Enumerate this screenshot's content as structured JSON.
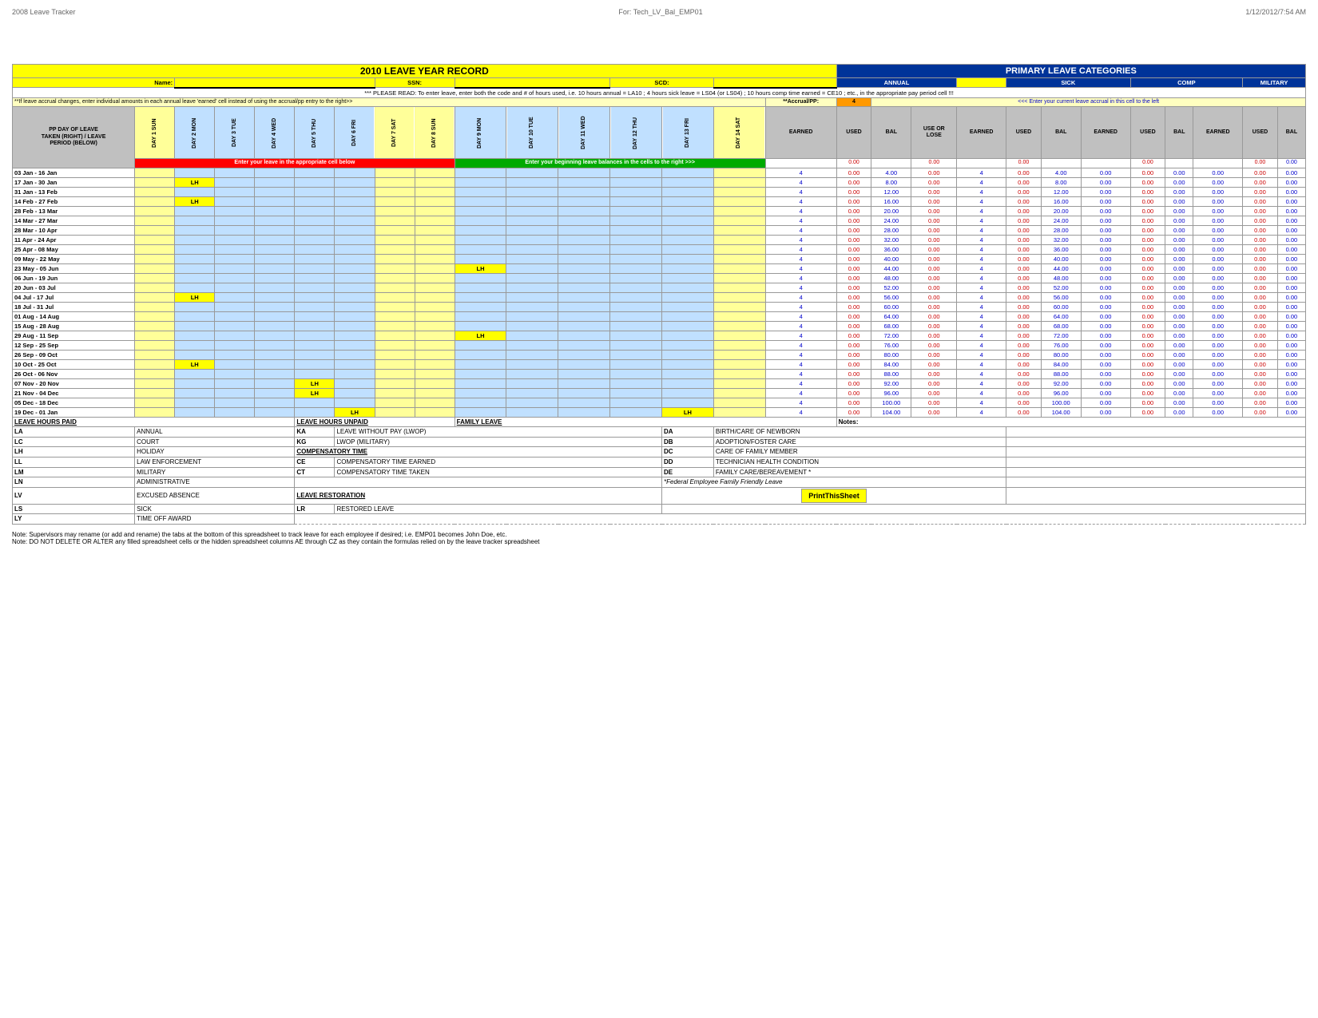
{
  "header": {
    "left": "2008 Leave Tracker",
    "center": "For: Tech_LV_Bal_EMP01",
    "right": "1/12/2012/7:54 AM"
  },
  "title": "2010 LEAVE YEAR RECORD",
  "primary_title": "PRIMARY LEAVE CATEGORIES",
  "labels": {
    "name": "Name:",
    "ssn": "SSN:",
    "scd": "SCD:",
    "annual": "ANNUAL",
    "sick": "SICK",
    "comp": "COMP",
    "military": "MILITARY"
  },
  "warning": "*** PLEASE READ: To enter leave, enter both the code and # of hours used, i.e. 10 hours annual = LA10 ; 4 hours sick leave = LS04 (or LS04) ; 10 hours comp time earned = CE10 ; etc., in the appropriate pay period cell !!!",
  "accrual_note": "**If leave accrual changes, enter individual amounts in each  annual leave 'earned' cell instead of using the accrual/pp entry to the right>>",
  "accrual_pp": "**Accrual/PP:",
  "accrual_val": "4",
  "enter_left_msg": "Enter your leave in the appropriate cell below",
  "enter_right_msg": "Enter your beginning leave balances in the cells to the right >>>",
  "cols_annual": [
    "EARNED",
    "USED",
    "BAL",
    "USE OR LOSE"
  ],
  "cols_sick": [
    "EARNED",
    "USED",
    "BAL"
  ],
  "cols_comp": [
    "EARNED",
    "USED",
    "BAL"
  ],
  "cols_military": [
    "EARNED",
    "USED",
    "BAL"
  ],
  "days": [
    "DAY 1 SUN",
    "DAY 2 MON",
    "DAY 3 TUE",
    "DAY 4 WED",
    "DAY 5 THU",
    "DAY 6 FRI",
    "DAY 7 SAT",
    "DAY 8 SUN",
    "DAY 9 MON",
    "DAY 10 TUE",
    "DAY 11 WED",
    "DAY 12 THU",
    "DAY 13 FRI",
    "DAY 14 SAT"
  ],
  "pp_header": "PP DAY OF LEAVE\nTAKEN (RIGHT) / LEAVE\nPERIOD (BELOW)",
  "rows": [
    {
      "date": "03 Jan - 16 Jan",
      "days": [
        "",
        "",
        "",
        "",
        "",
        "",
        "",
        "",
        "",
        "",
        "",
        "",
        "",
        ""
      ],
      "earned": "4",
      "used": "0.00",
      "bal": "4.00",
      "uol": "0.00",
      "s_earned": "4",
      "s_used": "0.00",
      "s_bal": "4.00",
      "c_earned": "0.00",
      "c_used": "0.00",
      "c_bal": "0.00",
      "m_earned": "0.00",
      "m_used": "0.00",
      "m_bal": "0.00"
    },
    {
      "date": "17 Jan - 30 Jan",
      "days": [
        "",
        "LH",
        "",
        "",
        "",
        "",
        "",
        "",
        "",
        "",
        "",
        "",
        "",
        ""
      ],
      "earned": "4",
      "used": "0.00",
      "bal": "8.00",
      "uol": "0.00",
      "s_earned": "4",
      "s_used": "0.00",
      "s_bal": "8.00",
      "c_earned": "0.00",
      "c_used": "0.00",
      "c_bal": "0.00",
      "m_earned": "0.00",
      "m_used": "0.00",
      "m_bal": "0.00"
    },
    {
      "date": "31 Jan - 13 Feb",
      "days": [
        "",
        "",
        "",
        "",
        "",
        "",
        "",
        "",
        "",
        "",
        "",
        "",
        "",
        ""
      ],
      "earned": "4",
      "used": "0.00",
      "bal": "12.00",
      "uol": "0.00",
      "s_earned": "4",
      "s_used": "0.00",
      "s_bal": "12.00",
      "c_earned": "0.00",
      "c_used": "0.00",
      "c_bal": "0.00",
      "m_earned": "0.00",
      "m_used": "0.00",
      "m_bal": "0.00"
    },
    {
      "date": "14 Feb - 27 Feb",
      "days": [
        "",
        "LH",
        "",
        "",
        "",
        "",
        "",
        "",
        "",
        "",
        "",
        "",
        "",
        ""
      ],
      "earned": "4",
      "used": "0.00",
      "bal": "16.00",
      "uol": "0.00",
      "s_earned": "4",
      "s_used": "0.00",
      "s_bal": "16.00",
      "c_earned": "0.00",
      "c_used": "0.00",
      "c_bal": "0.00",
      "m_earned": "0.00",
      "m_used": "0.00",
      "m_bal": "0.00"
    },
    {
      "date": "28 Feb - 13 Mar",
      "days": [
        "",
        "",
        "",
        "",
        "",
        "",
        "",
        "",
        "",
        "",
        "",
        "",
        "",
        ""
      ],
      "earned": "4",
      "used": "0.00",
      "bal": "20.00",
      "uol": "0.00",
      "s_earned": "4",
      "s_used": "0.00",
      "s_bal": "20.00",
      "c_earned": "0.00",
      "c_used": "0.00",
      "c_bal": "0.00",
      "m_earned": "0.00",
      "m_used": "0.00",
      "m_bal": "0.00"
    },
    {
      "date": "14 Mar - 27 Mar",
      "days": [
        "",
        "",
        "",
        "",
        "",
        "",
        "",
        "",
        "",
        "",
        "",
        "",
        "",
        ""
      ],
      "earned": "4",
      "used": "0.00",
      "bal": "24.00",
      "uol": "0.00",
      "s_earned": "4",
      "s_used": "0.00",
      "s_bal": "24.00",
      "c_earned": "0.00",
      "c_used": "0.00",
      "c_bal": "0.00",
      "m_earned": "0.00",
      "m_used": "0.00",
      "m_bal": "0.00"
    },
    {
      "date": "28 Mar - 10 Apr",
      "days": [
        "",
        "",
        "",
        "",
        "",
        "",
        "",
        "",
        "",
        "",
        "",
        "",
        "",
        ""
      ],
      "earned": "4",
      "used": "0.00",
      "bal": "28.00",
      "uol": "0.00",
      "s_earned": "4",
      "s_used": "0.00",
      "s_bal": "28.00",
      "c_earned": "0.00",
      "c_used": "0.00",
      "c_bal": "0.00",
      "m_earned": "0.00",
      "m_used": "0.00",
      "m_bal": "0.00"
    },
    {
      "date": "11 Apr - 24 Apr",
      "days": [
        "",
        "",
        "",
        "",
        "",
        "",
        "",
        "",
        "",
        "",
        "",
        "",
        "",
        ""
      ],
      "earned": "4",
      "used": "0.00",
      "bal": "32.00",
      "uol": "0.00",
      "s_earned": "4",
      "s_used": "0.00",
      "s_bal": "32.00",
      "c_earned": "0.00",
      "c_used": "0.00",
      "c_bal": "0.00",
      "m_earned": "0.00",
      "m_used": "0.00",
      "m_bal": "0.00"
    },
    {
      "date": "25 Apr - 08 May",
      "days": [
        "",
        "",
        "",
        "",
        "",
        "",
        "",
        "",
        "",
        "",
        "",
        "",
        "",
        ""
      ],
      "earned": "4",
      "used": "0.00",
      "bal": "36.00",
      "uol": "0.00",
      "s_earned": "4",
      "s_used": "0.00",
      "s_bal": "36.00",
      "c_earned": "0.00",
      "c_used": "0.00",
      "c_bal": "0.00",
      "m_earned": "0.00",
      "m_used": "0.00",
      "m_bal": "0.00"
    },
    {
      "date": "09 May - 22 May",
      "days": [
        "",
        "",
        "",
        "",
        "",
        "",
        "",
        "",
        "",
        "",
        "",
        "",
        "",
        ""
      ],
      "earned": "4",
      "used": "0.00",
      "bal": "40.00",
      "uol": "0.00",
      "s_earned": "4",
      "s_used": "0.00",
      "s_bal": "40.00",
      "c_earned": "0.00",
      "c_used": "0.00",
      "c_bal": "0.00",
      "m_earned": "0.00",
      "m_used": "0.00",
      "m_bal": "0.00"
    },
    {
      "date": "23 May - 05 Jun",
      "days": [
        "",
        "",
        "",
        "",
        "",
        "",
        "",
        "",
        "LH",
        "",
        "",
        "",
        "",
        ""
      ],
      "earned": "4",
      "used": "0.00",
      "bal": "44.00",
      "uol": "0.00",
      "s_earned": "4",
      "s_used": "0.00",
      "s_bal": "44.00",
      "c_earned": "0.00",
      "c_used": "0.00",
      "c_bal": "0.00",
      "m_earned": "0.00",
      "m_used": "0.00",
      "m_bal": "0.00"
    },
    {
      "date": "06 Jun - 19 Jun",
      "days": [
        "",
        "",
        "",
        "",
        "",
        "",
        "",
        "",
        "",
        "",
        "",
        "",
        "",
        ""
      ],
      "earned": "4",
      "used": "0.00",
      "bal": "48.00",
      "uol": "0.00",
      "s_earned": "4",
      "s_used": "0.00",
      "s_bal": "48.00",
      "c_earned": "0.00",
      "c_used": "0.00",
      "c_bal": "0.00",
      "m_earned": "0.00",
      "m_used": "0.00",
      "m_bal": "0.00"
    },
    {
      "date": "20 Jun - 03 Jul",
      "days": [
        "",
        "",
        "",
        "",
        "",
        "",
        "",
        "",
        "",
        "",
        "",
        "",
        "",
        ""
      ],
      "earned": "4",
      "used": "0.00",
      "bal": "52.00",
      "uol": "0.00",
      "s_earned": "4",
      "s_used": "0.00",
      "s_bal": "52.00",
      "c_earned": "0.00",
      "c_used": "0.00",
      "c_bal": "0.00",
      "m_earned": "0.00",
      "m_used": "0.00",
      "m_bal": "0.00"
    },
    {
      "date": "04 Jul - 17 Jul",
      "days": [
        "",
        "LH",
        "",
        "",
        "",
        "",
        "",
        "",
        "",
        "",
        "",
        "",
        "",
        ""
      ],
      "earned": "4",
      "used": "0.00",
      "bal": "56.00",
      "uol": "0.00",
      "s_earned": "4",
      "s_used": "0.00",
      "s_bal": "56.00",
      "c_earned": "0.00",
      "c_used": "0.00",
      "c_bal": "0.00",
      "m_earned": "0.00",
      "m_used": "0.00",
      "m_bal": "0.00"
    },
    {
      "date": "18 Jul - 31 Jul",
      "days": [
        "",
        "",
        "",
        "",
        "",
        "",
        "",
        "",
        "",
        "",
        "",
        "",
        "",
        ""
      ],
      "earned": "4",
      "used": "0.00",
      "bal": "60.00",
      "uol": "0.00",
      "s_earned": "4",
      "s_used": "0.00",
      "s_bal": "60.00",
      "c_earned": "0.00",
      "c_used": "0.00",
      "c_bal": "0.00",
      "m_earned": "0.00",
      "m_used": "0.00",
      "m_bal": "0.00"
    },
    {
      "date": "01 Aug - 14 Aug",
      "days": [
        "",
        "",
        "",
        "",
        "",
        "",
        "",
        "",
        "",
        "",
        "",
        "",
        "",
        ""
      ],
      "earned": "4",
      "used": "0.00",
      "bal": "64.00",
      "uol": "0.00",
      "s_earned": "4",
      "s_used": "0.00",
      "s_bal": "64.00",
      "c_earned": "0.00",
      "c_used": "0.00",
      "c_bal": "0.00",
      "m_earned": "0.00",
      "m_used": "0.00",
      "m_bal": "0.00"
    },
    {
      "date": "15 Aug - 28 Aug",
      "days": [
        "",
        "",
        "",
        "",
        "",
        "",
        "",
        "",
        "",
        "",
        "",
        "",
        "",
        ""
      ],
      "earned": "4",
      "used": "0.00",
      "bal": "68.00",
      "uol": "0.00",
      "s_earned": "4",
      "s_used": "0.00",
      "s_bal": "68.00",
      "c_earned": "0.00",
      "c_used": "0.00",
      "c_bal": "0.00",
      "m_earned": "0.00",
      "m_used": "0.00",
      "m_bal": "0.00"
    },
    {
      "date": "29 Aug - 11 Sep",
      "days": [
        "",
        "",
        "",
        "",
        "",
        "",
        "",
        "",
        "LH",
        "",
        "",
        "",
        "",
        ""
      ],
      "earned": "4",
      "used": "0.00",
      "bal": "72.00",
      "uol": "0.00",
      "s_earned": "4",
      "s_used": "0.00",
      "s_bal": "72.00",
      "c_earned": "0.00",
      "c_used": "0.00",
      "c_bal": "0.00",
      "m_earned": "0.00",
      "m_used": "0.00",
      "m_bal": "0.00"
    },
    {
      "date": "12 Sep - 25 Sep",
      "days": [
        "",
        "",
        "",
        "",
        "",
        "",
        "",
        "",
        "",
        "",
        "",
        "",
        "",
        ""
      ],
      "earned": "4",
      "used": "0.00",
      "bal": "76.00",
      "uol": "0.00",
      "s_earned": "4",
      "s_used": "0.00",
      "s_bal": "76.00",
      "c_earned": "0.00",
      "c_used": "0.00",
      "c_bal": "0.00",
      "m_earned": "0.00",
      "m_used": "0.00",
      "m_bal": "0.00"
    },
    {
      "date": "26 Sep - 09 Oct",
      "days": [
        "",
        "",
        "",
        "",
        "",
        "",
        "",
        "",
        "",
        "",
        "",
        "",
        "",
        ""
      ],
      "earned": "4",
      "used": "0.00",
      "bal": "80.00",
      "uol": "0.00",
      "s_earned": "4",
      "s_used": "0.00",
      "s_bal": "80.00",
      "c_earned": "0.00",
      "c_used": "0.00",
      "c_bal": "0.00",
      "m_earned": "0.00",
      "m_used": "0.00",
      "m_bal": "0.00"
    },
    {
      "date": "10 Oct - 25 Oct",
      "days": [
        "",
        "LH",
        "",
        "",
        "",
        "",
        "",
        "",
        "",
        "",
        "",
        "",
        "",
        ""
      ],
      "earned": "4",
      "used": "0.00",
      "bal": "84.00",
      "uol": "0.00",
      "s_earned": "4",
      "s_used": "0.00",
      "s_bal": "84.00",
      "c_earned": "0.00",
      "c_used": "0.00",
      "c_bal": "0.00",
      "m_earned": "0.00",
      "m_used": "0.00",
      "m_bal": "0.00"
    },
    {
      "date": "26 Oct - 06 Nov",
      "days": [
        "",
        "",
        "",
        "",
        "",
        "",
        "",
        "",
        "",
        "",
        "",
        "",
        "",
        ""
      ],
      "earned": "4",
      "used": "0.00",
      "bal": "88.00",
      "uol": "0.00",
      "s_earned": "4",
      "s_used": "0.00",
      "s_bal": "88.00",
      "c_earned": "0.00",
      "c_used": "0.00",
      "c_bal": "0.00",
      "m_earned": "0.00",
      "m_used": "0.00",
      "m_bal": "0.00"
    },
    {
      "date": "07 Nov - 20 Nov",
      "days": [
        "",
        "",
        "",
        "",
        "LH",
        "",
        "",
        "",
        "",
        "",
        "",
        "",
        "",
        ""
      ],
      "earned": "4",
      "used": "0.00",
      "bal": "92.00",
      "uol": "0.00",
      "s_earned": "4",
      "s_used": "0.00",
      "s_bal": "92.00",
      "c_earned": "0.00",
      "c_used": "0.00",
      "c_bal": "0.00",
      "m_earned": "0.00",
      "m_used": "0.00",
      "m_bal": "0.00"
    },
    {
      "date": "21 Nov - 04 Dec",
      "days": [
        "",
        "",
        "",
        "",
        "LH",
        "",
        "",
        "",
        "",
        "",
        "",
        "",
        "",
        ""
      ],
      "earned": "4",
      "used": "0.00",
      "bal": "96.00",
      "uol": "0.00",
      "s_earned": "4",
      "s_used": "0.00",
      "s_bal": "96.00",
      "c_earned": "0.00",
      "c_used": "0.00",
      "c_bal": "0.00",
      "m_earned": "0.00",
      "m_used": "0.00",
      "m_bal": "0.00"
    },
    {
      "date": "05 Dec - 18 Dec",
      "days": [
        "",
        "",
        "",
        "",
        "",
        "",
        "",
        "",
        "",
        "",
        "",
        "",
        "",
        ""
      ],
      "earned": "4",
      "used": "0.00",
      "bal": "100.00",
      "uol": "0.00",
      "s_earned": "4",
      "s_used": "0.00",
      "s_bal": "100.00",
      "c_earned": "0.00",
      "c_used": "0.00",
      "c_bal": "0.00",
      "m_earned": "0.00",
      "m_used": "0.00",
      "m_bal": "0.00"
    },
    {
      "date": "19 Dec - 01 Jan",
      "days": [
        "",
        "",
        "",
        "",
        "",
        "LH",
        "",
        "",
        "",
        "",
        "",
        "",
        "LH",
        ""
      ],
      "earned": "4",
      "used": "0.00",
      "bal": "104.00",
      "uol": "0.00",
      "s_earned": "4",
      "s_used": "0.00",
      "s_bal": "104.00",
      "c_earned": "0.00",
      "c_used": "0.00",
      "c_bal": "0.00",
      "m_earned": "0.00",
      "m_used": "0.00",
      "m_bal": "0.00"
    }
  ],
  "leave_codes": {
    "paid_title": "LEAVE HOURS PAID",
    "unpaid_title": "LEAVE HOURS UNPAID",
    "family_title": "FAMILY LEAVE",
    "comp_title": "COMPENSATORY TIME",
    "restore_title": "LEAVE RESTORATION",
    "paid": [
      {
        "code": "LA",
        "desc": "ANNUAL"
      },
      {
        "code": "LC",
        "desc": "COURT"
      },
      {
        "code": "LH",
        "desc": "HOLIDAY"
      },
      {
        "code": "LL",
        "desc": "LAW ENFORCEMENT"
      },
      {
        "code": "LM",
        "desc": "MILITARY"
      },
      {
        "code": "LN",
        "desc": "ADMINISTRATIVE"
      },
      {
        "code": "LV",
        "desc": "EXCUSED ABSENCE"
      },
      {
        "code": "LS",
        "desc": "SICK"
      },
      {
        "code": "LY",
        "desc": "TIME OFF AWARD"
      }
    ],
    "unpaid": [
      {
        "code": "KA",
        "desc": "LEAVE WITHOUT PAY (LWOP)"
      },
      {
        "code": "KG",
        "desc": "LWOP (MILITARY)"
      },
      {
        "code": "",
        "desc": ""
      },
      {
        "code": "CE",
        "desc": "COMPENSATORY TIME EARNED"
      },
      {
        "code": "CT",
        "desc": "COMPENSATORY TIME TAKEN"
      },
      {
        "code": "",
        "desc": ""
      },
      {
        "code": "LR",
        "desc": "RESTORED LEAVE"
      }
    ],
    "family": [
      {
        "code": "DA",
        "desc": "BIRTH/CARE OF NEWBORN"
      },
      {
        "code": "DB",
        "desc": "ADOPTION/FOSTER CARE"
      },
      {
        "code": "DC",
        "desc": "CARE OF FAMILY MEMBER"
      },
      {
        "code": "DD",
        "desc": "TECHNICIAN HEALTH CONDITION"
      },
      {
        "code": "DE",
        "desc": "FAMILY CARE/BEREAVEMENT *"
      },
      {
        "code": "",
        "desc": "*Federal Employee Family Friendly Leave"
      }
    ]
  },
  "notes_label": "Notes:",
  "print_label": "PrintThisSheet",
  "footer": [
    "Note:  Supervisors may rename (or add and rename) the tabs at the bottom of this spreadsheet to track leave for each employee if desired; i.e. EMP01 becomes John Doe, etc.",
    "Note: DO NOT DELETE OR ALTER any filled spreadsheet cells or the hidden spreadsheet columns AE through CZ as they contain the formulas relied on by the leave tracker spreadsheet"
  ]
}
